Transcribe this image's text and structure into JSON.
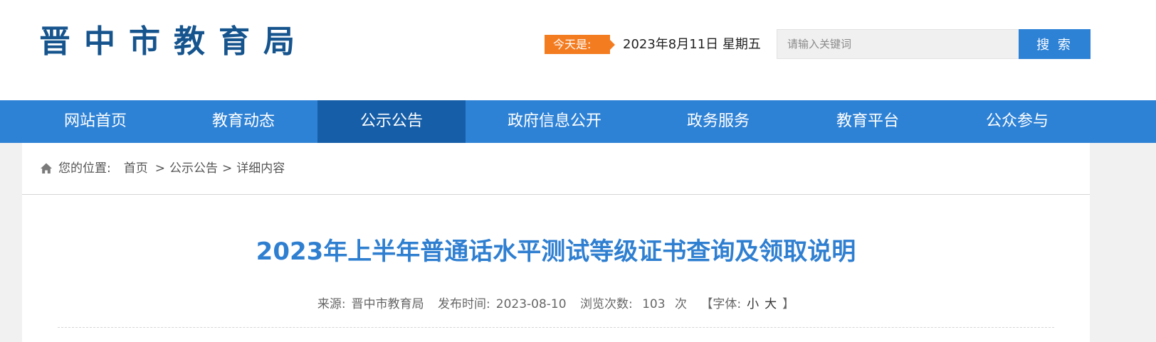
{
  "header": {
    "logo_text": "晋中市教育局",
    "date_label": "今天是:",
    "date_value": "2023年8月11日 星期五",
    "search_placeholder": "请输入关键词",
    "search_button": "搜 索"
  },
  "nav": {
    "items": [
      "网站首页",
      "教育动态",
      "公示公告",
      "政府信息公开",
      "政务服务",
      "教育平台",
      "公众参与"
    ],
    "active": "公示公告",
    "accent": "#2e82d6",
    "active_color": "#165ea8"
  },
  "breadcrumb": {
    "icon": "home-icon",
    "prefix": "您的位置:",
    "home": "首页",
    "sep": ">",
    "section": "公示公告",
    "current": "详细内容"
  },
  "article": {
    "title": "2023年上半年普通话水平测试等级证书查询及领取说明",
    "source_label": "来源:",
    "source": "晋中市教育局",
    "published_label": "发布时间:",
    "published": "2023-08-10",
    "views_label": "浏览次数:",
    "views": "103",
    "views_unit": "次",
    "font_label": "【字体:",
    "font_small": "小",
    "font_large": "大",
    "font_close": "】"
  }
}
